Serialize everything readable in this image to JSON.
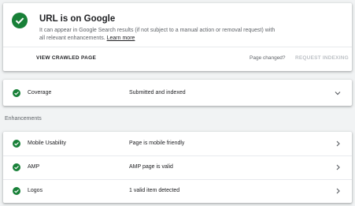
{
  "status": {
    "title": "URL is on Google",
    "description": "It can appear in Google Search results (if not subject to a manual action or removal request) with all relevant enhancements.",
    "learn_more": "Learn more",
    "icon": "check-circle-icon",
    "icon_color": "#188038"
  },
  "actions": {
    "view_crawled": "VIEW CRAWLED PAGE",
    "page_changed": "Page changed?",
    "request_indexing": "REQUEST INDEXING"
  },
  "coverage": {
    "label": "Coverage",
    "value": "Submitted and indexed",
    "icon": "check-icon",
    "chevron": "chevron-down-icon"
  },
  "enhancements": {
    "title": "Enhancements",
    "items": [
      {
        "label": "Mobile Usability",
        "value": "Page is mobile friendly",
        "icon": "check-icon",
        "chevron": "chevron-right-icon"
      },
      {
        "label": "AMP",
        "value": "AMP page is valid",
        "icon": "check-icon",
        "chevron": "chevron-right-icon"
      },
      {
        "label": "Logos",
        "value": "1 valid item detected",
        "icon": "check-icon",
        "chevron": "chevron-right-icon"
      }
    ]
  },
  "colors": {
    "success": "#188038",
    "disabled": "#bdc1c6"
  }
}
